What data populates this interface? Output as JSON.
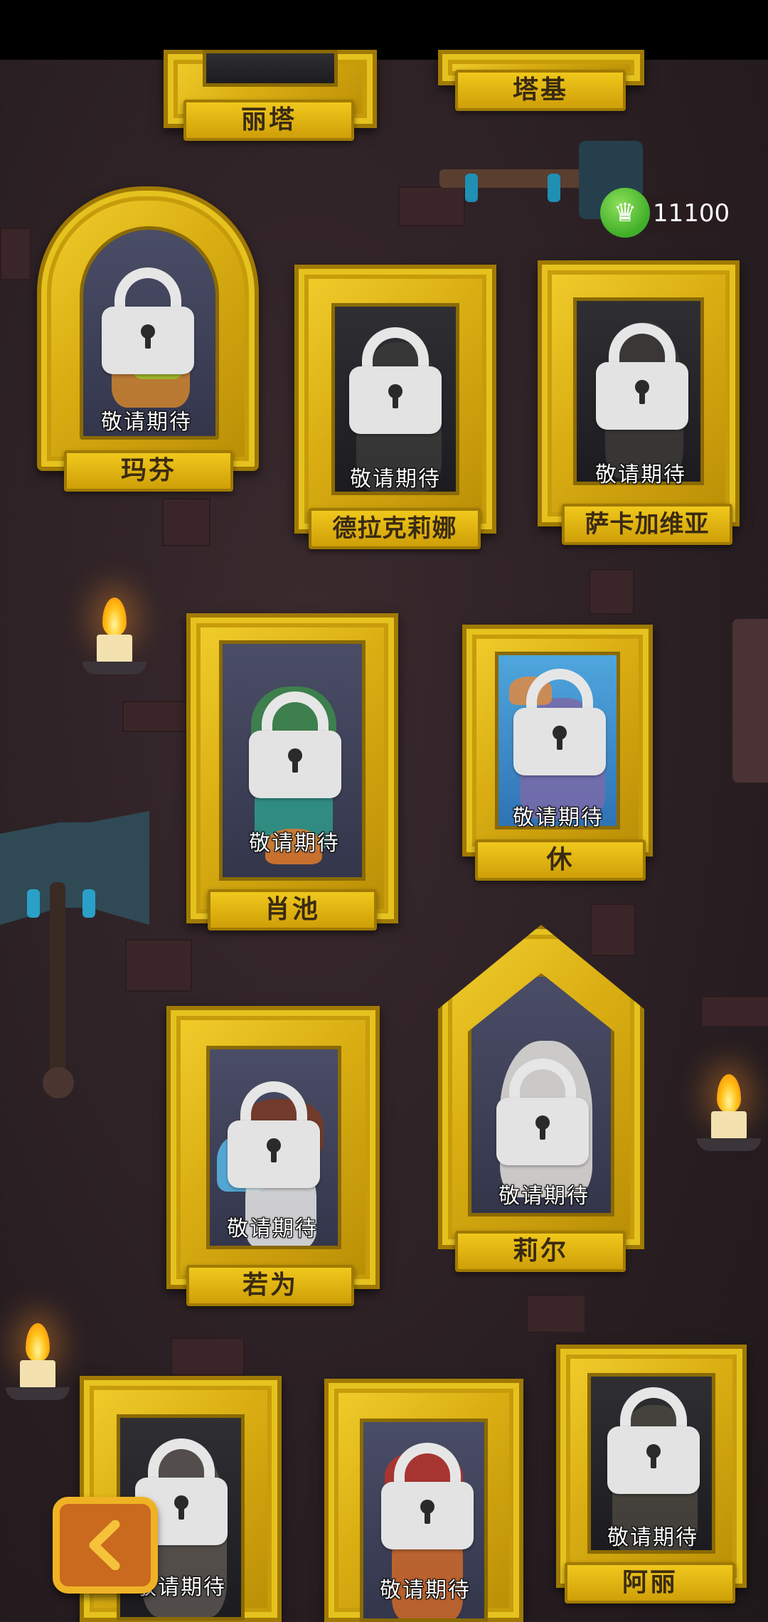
{
  "score": {
    "value": "11100",
    "icon": "crown-icon"
  },
  "locked_text": "敬请期待",
  "characters": [
    {
      "name": "丽塔",
      "locked": false
    },
    {
      "name": "塔基",
      "locked": false
    },
    {
      "name": "玛芬",
      "locked": true
    },
    {
      "name": "德拉克莉娜",
      "locked": true
    },
    {
      "name": "萨卡加维亚",
      "locked": true
    },
    {
      "name": "肖池",
      "locked": true
    },
    {
      "name": "休",
      "locked": true
    },
    {
      "name": "若为",
      "locked": true
    },
    {
      "name": "莉尔",
      "locked": true
    },
    {
      "name": "",
      "locked": true
    },
    {
      "name": "",
      "locked": true
    },
    {
      "name": "阿丽",
      "locked": true
    }
  ],
  "back_icon": "chevron-left-icon",
  "colors": {
    "frame_gold": "#e0b816",
    "accent_orange": "#c96a1e",
    "crown_green": "#3fae28"
  }
}
